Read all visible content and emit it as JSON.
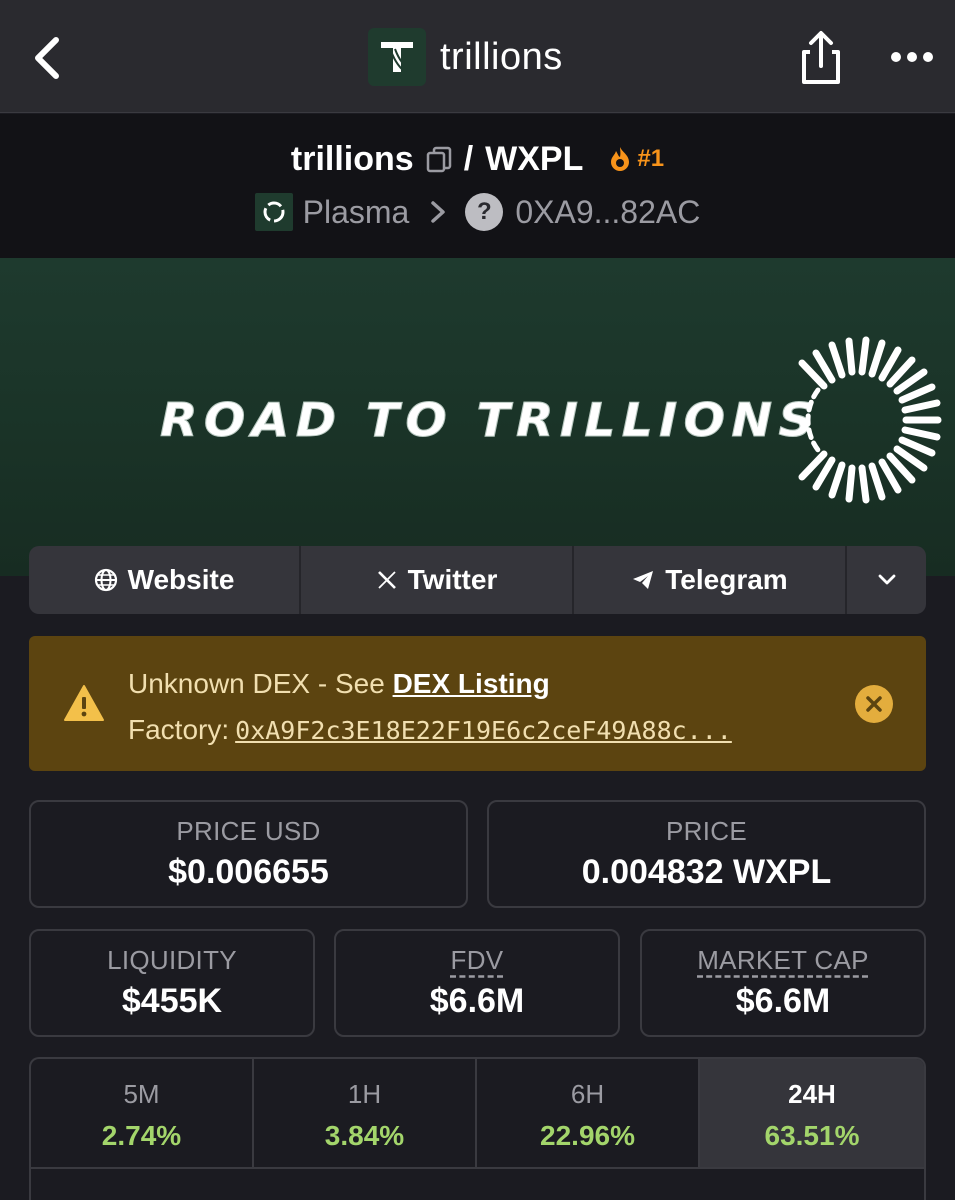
{
  "header": {
    "title": "trillions",
    "icons": [
      "chevron-left-icon",
      "trillions-logo",
      "share-icon",
      "more-icon"
    ]
  },
  "pair": {
    "base": "trillions",
    "separator": "/",
    "quote": "WXPL",
    "rank": "#1",
    "chain": "Plasma",
    "address": "0XA9...82AC"
  },
  "banner": {
    "text": "ROAD TO TRILLIONS"
  },
  "links": {
    "website": "Website",
    "twitter": "Twitter",
    "telegram": "Telegram"
  },
  "warning": {
    "prefix": "Unknown DEX - See",
    "link": "DEX Listing",
    "factory_label": "Factory:",
    "factory_address": "0xA9F2c3E18E22F19E6c2ceF49A88c..."
  },
  "stats": {
    "price_usd": {
      "label": "PRICE USD",
      "value": "$0.006655"
    },
    "price": {
      "label": "PRICE",
      "value": "0.004832 WXPL"
    },
    "liquidity": {
      "label": "LIQUIDITY",
      "value": "$455K"
    },
    "fdv": {
      "label": "FDV",
      "value": "$6.6M"
    },
    "market_cap": {
      "label": "MARKET CAP",
      "value": "$6.6M"
    }
  },
  "changes": [
    {
      "label": "5M",
      "value": "2.74%"
    },
    {
      "label": "1H",
      "value": "3.84%"
    },
    {
      "label": "6H",
      "value": "22.96%"
    },
    {
      "label": "24H",
      "value": "63.51%",
      "active": true
    }
  ],
  "colors": {
    "background": "#1b1b21",
    "positive": "#a3d56b",
    "rank": "#f7931a",
    "warning_bg": "#5c4410",
    "banner_green": "#1e3a2e"
  }
}
